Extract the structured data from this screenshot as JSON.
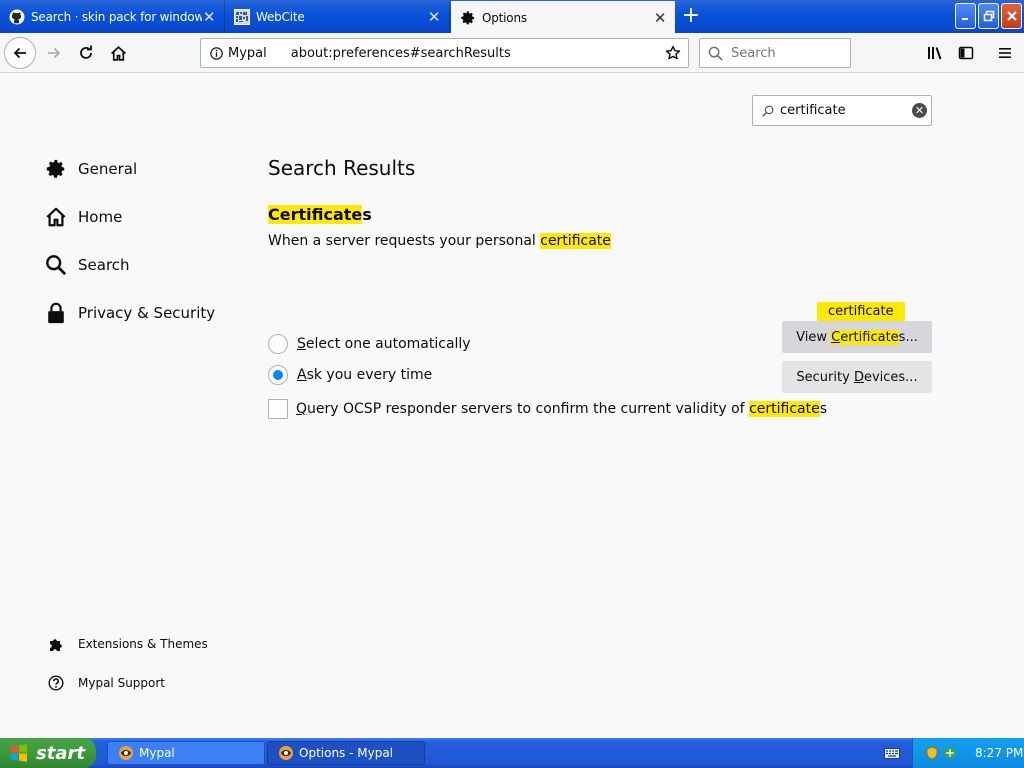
{
  "tabs": [
    {
      "label": "Search · skin pack for windows xp",
      "icon": "github-icon",
      "active": false
    },
    {
      "label": "WebCite",
      "icon": "webcite-icon",
      "active": false
    },
    {
      "label": "Options",
      "icon": "gear-icon",
      "active": true
    }
  ],
  "toolbar": {
    "identity_label": "Mypal",
    "url": "about:preferences#searchResults",
    "search_placeholder": "Search"
  },
  "prefs": {
    "search_value": "certificate",
    "categories": [
      {
        "label": "General",
        "icon": "gear-icon"
      },
      {
        "label": "Home",
        "icon": "home-icon"
      },
      {
        "label": "Search",
        "icon": "magnifier-icon"
      },
      {
        "label": "Privacy & Security",
        "icon": "lock-icon"
      }
    ],
    "footer_links": [
      {
        "label": "Extensions & Themes",
        "icon": "puzzle-icon"
      },
      {
        "label": "Mypal Support",
        "icon": "help-icon"
      }
    ],
    "results_title": "Search Results",
    "group_title_hl": "Certificate",
    "group_title_rest": "s",
    "group_desc_text": "When a server requests your personal ",
    "group_desc_hl": "certificate",
    "radio_auto_first": "S",
    "radio_auto_rest": "elect one automatically",
    "radio_ask_first": "A",
    "radio_ask_rest": "sk you every time",
    "ocsp_first": "Q",
    "ocsp_mid": "uery OCSP responder servers to confirm the current validity of ",
    "ocsp_hl": "certificate",
    "ocsp_rest": "s",
    "view_pre": "View ",
    "view_c": "C",
    "view_hl": "ertificate",
    "view_rest": "s...",
    "devices_pre": "Security ",
    "devices_d": "D",
    "devices_rest": "evices...",
    "tooltip": "certificate",
    "selected_radio": "ask"
  },
  "taskbar": {
    "start_label": "start",
    "tasks": [
      {
        "label": "Mypal",
        "active": false
      },
      {
        "label": "Options - Mypal",
        "active": true
      }
    ],
    "clock": "8:27 PM"
  },
  "colors": {
    "highlight": "#ffe900",
    "accent": "#0a84ff",
    "xp_blue": "#245edb",
    "start_green": "#3c9a3c"
  }
}
